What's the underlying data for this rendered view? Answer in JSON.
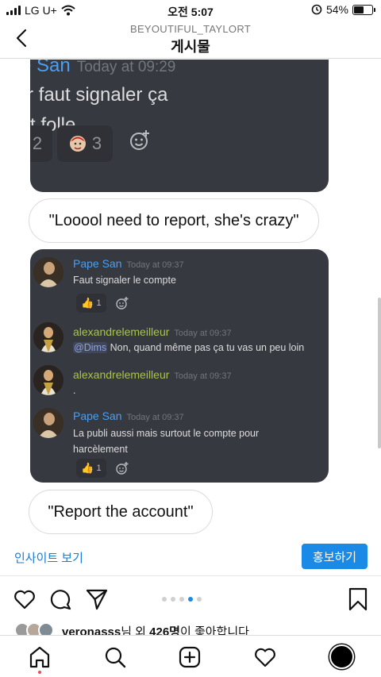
{
  "status_bar": {
    "carrier": "LG U+",
    "time": "오전 5:07",
    "battery_percent": "54%",
    "battery_level": 0.54
  },
  "header": {
    "username": "BEYOUTIFUL_TAYLORT",
    "title": "게시물"
  },
  "screenshot_top": {
    "author": "e San",
    "timestamp": "Today at 09:29",
    "lines": [
      "rr faut signaler ça",
      "st folle"
    ],
    "reactions": [
      {
        "count": "2"
      },
      {
        "count": "3"
      }
    ]
  },
  "caption_1": "\"Looool need to report, she's crazy\"",
  "discord_messages": [
    {
      "author": "Pape San",
      "author_color": "#4a9ff2",
      "timestamp": "Today at 09:37",
      "text": "Faut signaler le compte",
      "reaction_count": "1"
    },
    {
      "author": "alexandrelemeilleur",
      "author_color": "#a8c44a",
      "timestamp": "Today at 09:37",
      "mention": "@Dims",
      "text": "Non, quand même pas ça tu vas un peu loin"
    },
    {
      "author": "alexandrelemeilleur",
      "author_color": "#a8c44a",
      "timestamp": "Today at 09:37",
      "text": "."
    },
    {
      "author": "Pape San",
      "author_color": "#4a9ff2",
      "timestamp": "Today at 09:37",
      "text_lines": [
        "La publi aussi mais surtout le compte pour",
        "harcèlement"
      ],
      "reaction_count": "1"
    }
  ],
  "caption_2": "\"Report the account\"",
  "insights": {
    "link_label": "인사이트 보기",
    "promote_label": "홍보하기"
  },
  "carousel": {
    "count": 5,
    "active_index": 3
  },
  "likes": {
    "username": "veronasss",
    "middle": "님 외 ",
    "count": "426명",
    "suffix": "이 좋아합니다"
  },
  "colors": {
    "accent": "#1a8ae6",
    "discord_bg": "#36393f",
    "discord_blue_name": "#4a9ff2",
    "discord_green_name": "#a8c44a"
  },
  "icons": [
    "wifi-icon",
    "alarm-icon",
    "back-arrow-icon",
    "heart-icon",
    "comment-icon",
    "share-icon",
    "bookmark-icon",
    "home-icon",
    "search-icon",
    "add-post-icon",
    "activity-icon"
  ]
}
